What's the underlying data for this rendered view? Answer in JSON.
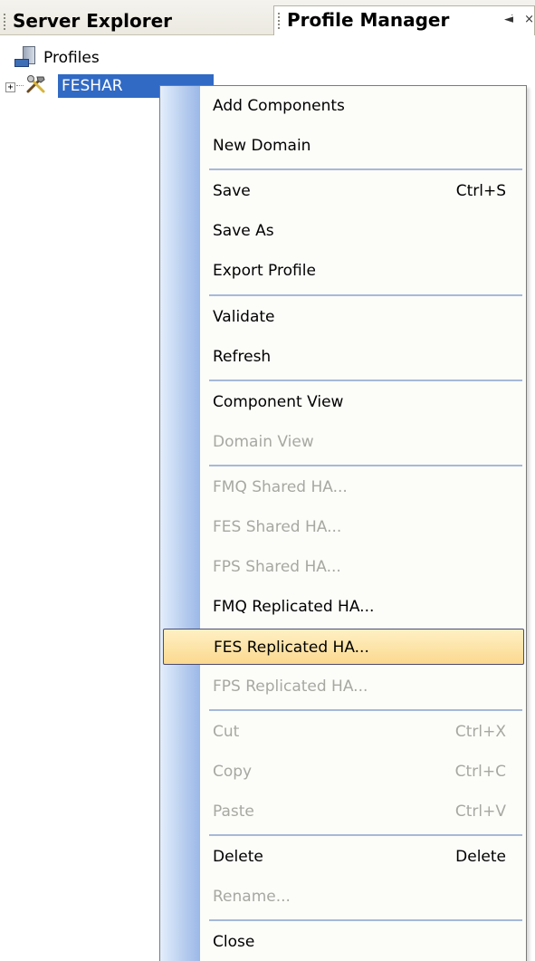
{
  "tabs": {
    "server_explorer": "Server Explorer",
    "profile_manager": "Profile Manager",
    "pin_glyph": "◄ׁ",
    "close_glyph": "×"
  },
  "tree": {
    "root_label": "Profiles",
    "root_icon": "server-icon",
    "expander_glyph": "+",
    "node_icon": "tools-icon",
    "node_label": "FESHAR"
  },
  "menu": {
    "items": [
      {
        "label": "Add Components",
        "shortcut": "",
        "enabled": true
      },
      {
        "label": "New Domain",
        "shortcut": "",
        "enabled": true
      },
      {
        "label": "Save",
        "shortcut": "Ctrl+S",
        "enabled": true
      },
      {
        "label": "Save As",
        "shortcut": "",
        "enabled": true
      },
      {
        "label": "Export Profile",
        "shortcut": "",
        "enabled": true
      },
      {
        "label": "Validate",
        "shortcut": "",
        "enabled": true
      },
      {
        "label": "Refresh",
        "shortcut": "",
        "enabled": true
      },
      {
        "label": "Component View",
        "shortcut": "",
        "enabled": true
      },
      {
        "label": "Domain View",
        "shortcut": "",
        "enabled": false
      },
      {
        "label": "FMQ Shared HA...",
        "shortcut": "",
        "enabled": false
      },
      {
        "label": "FES Shared HA...",
        "shortcut": "",
        "enabled": false
      },
      {
        "label": "FPS Shared HA...",
        "shortcut": "",
        "enabled": false
      },
      {
        "label": "FMQ Replicated HA...",
        "shortcut": "",
        "enabled": true
      },
      {
        "label": "FES Replicated HA...",
        "shortcut": "",
        "enabled": true,
        "highlighted": true
      },
      {
        "label": "FPS Replicated HA...",
        "shortcut": "",
        "enabled": false
      },
      {
        "label": "Cut",
        "shortcut": "Ctrl+X",
        "enabled": false
      },
      {
        "label": "Copy",
        "shortcut": "Ctrl+C",
        "enabled": false
      },
      {
        "label": "Paste",
        "shortcut": "Ctrl+V",
        "enabled": false
      },
      {
        "label": "Delete",
        "shortcut": "Delete",
        "enabled": true
      },
      {
        "label": "Rename...",
        "shortcut": "",
        "enabled": false
      },
      {
        "label": "Close",
        "shortcut": "",
        "enabled": true
      }
    ]
  },
  "colors": {
    "selection": "#316ac5",
    "highlight": "#fbd98f",
    "disabled_text": "#a8a8a2",
    "gutter": "#b7cdee"
  }
}
